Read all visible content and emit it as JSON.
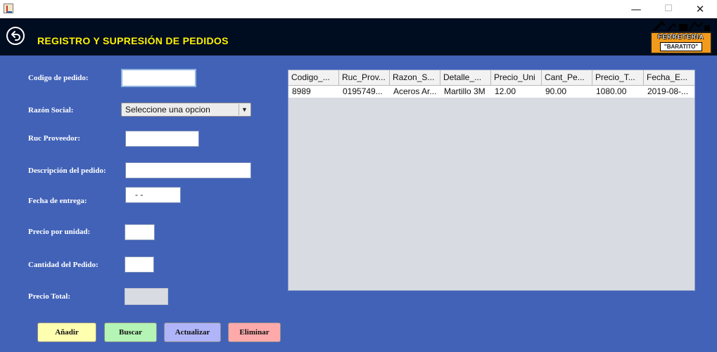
{
  "window": {
    "icon": "java-icon",
    "controls": [
      "—",
      "☐",
      "✕"
    ]
  },
  "header": {
    "back_icon": "back-arrow-icon",
    "title": "REGISTRO Y SUPRESIÓN DE PEDIDOS",
    "logo": {
      "line1": "FERRETERÍA",
      "line2": "\"BARATITO\""
    }
  },
  "form": {
    "codigo_label": "Codigo de pedido:",
    "codigo_value": "",
    "razon_label": "Razón Social:",
    "razon_selected": "Seleccione una opcion",
    "ruc_label": "Ruc Proveedor:",
    "ruc_value": "",
    "descripcion_label": "Descripción del pedido:",
    "descripcion_value": "",
    "fecha_label": "Fecha de entrega:",
    "fecha_value": "- -",
    "precio_unidad_label": "Precio por unidad:",
    "precio_unidad_value": "",
    "cantidad_label": "Cantidad del Pedido:",
    "cantidad_value": "",
    "precio_total_label": "Precio Total:",
    "precio_total_value": ""
  },
  "table": {
    "columns": [
      "Codigo_...",
      "Ruc_Prov...",
      "Razon_S...",
      "Detalle_...",
      "Precio_Uni",
      "Cant_Pe...",
      "Precio_T...",
      "Fecha_E..."
    ],
    "rows": [
      [
        "8989",
        "0195749...",
        "Aceros Ar...",
        "Martillo 3M",
        "12.00",
        "90.00",
        "1080.00",
        "2019-08-..."
      ]
    ]
  },
  "buttons": {
    "anadir": "Añadir",
    "buscar": "Buscar",
    "actualizar": "Actualizar",
    "eliminar": "Eliminar"
  },
  "colors": {
    "header_bg": "#000c20",
    "title": "#fff200",
    "panel_bg": "#4262b8",
    "btn_anadir": "#ffffb0",
    "btn_buscar": "#b4f4b4",
    "btn_actualizar": "#b0b4f8",
    "btn_eliminar": "#ffaaaa"
  }
}
